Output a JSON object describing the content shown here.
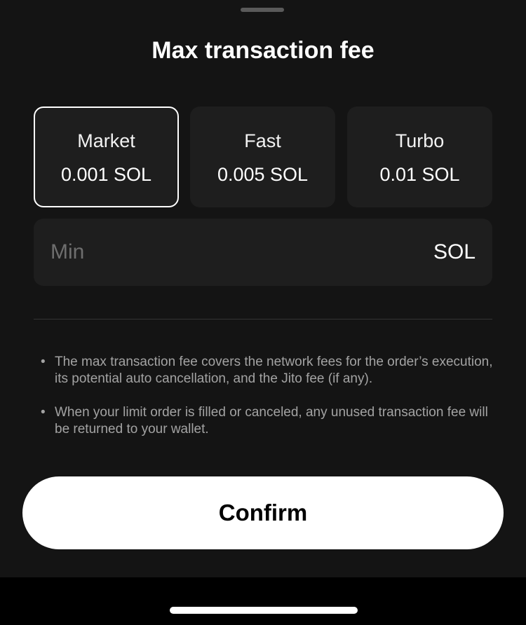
{
  "sheet": {
    "title": "Max transaction fee"
  },
  "fee_options": [
    {
      "name": "Market",
      "amount": "0.001 SOL",
      "selected": true
    },
    {
      "name": "Fast",
      "amount": "0.005 SOL",
      "selected": false
    },
    {
      "name": "Turbo",
      "amount": "0.01 SOL",
      "selected": false
    }
  ],
  "custom_fee": {
    "placeholder": "Min",
    "value": "",
    "unit": "SOL"
  },
  "notes": [
    "The max transaction fee covers the network fees for the order’s execution, its potential auto cancellation, and the Jito fee (if any).",
    "When your limit order is filled or canceled, any unused transaction fee will be returned to your wallet."
  ],
  "confirm_label": "Confirm",
  "colors": {
    "sheet_background": "#141414",
    "card_background": "#1e1e1e",
    "selected_border": "#ffffff",
    "muted_text": "#a3a3a3",
    "button_background": "#ffffff"
  }
}
